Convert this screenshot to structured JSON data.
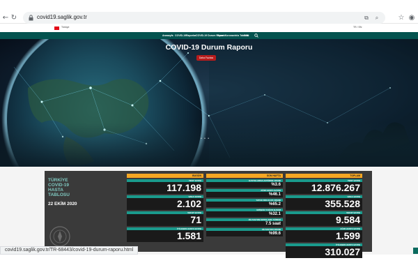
{
  "browser": {
    "url": "covid19.saglik.gov.tr",
    "status_url": "covid19.saglik.gov.tr/TR-68443/covid-19-durum-raporu.html",
    "icons": [
      "back-icon",
      "forward-icon",
      "reload-icon",
      "lock-icon",
      "translate-icon",
      "zoom-icon",
      "star-icon",
      "account-icon"
    ]
  },
  "site": {
    "gov_strip_left": "Türkiye",
    "gov_strip_right": "TR / EN",
    "nav": [
      "Anasayfa",
      "COVID-19",
      "Raporlar",
      "COVID-19 Durum Raporu",
      "Genel Koronavirüs Tablosu",
      "SSS"
    ],
    "search_icon": "search-icon"
  },
  "hero": {
    "title": "COVID-19 Durum Raporu",
    "button": "Daha Fazlası",
    "dots": "• • •"
  },
  "stats": {
    "left_title": [
      "TÜRKİYE",
      "COVID-19",
      "HASTA",
      "TABLOSU"
    ],
    "date": "22 EKİM 2020",
    "columns": [
      {
        "header": "BUGÜN",
        "color": "#f5a623",
        "cells": [
          {
            "label": "TEST SAYISI",
            "value": "117.198",
            "size": "big"
          },
          {
            "label": "VAKA SAYISI",
            "value": "2.102",
            "size": "big"
          },
          {
            "label": "VEFAT SAYISI",
            "value": "71",
            "size": "big"
          },
          {
            "label": "İYİLEŞEN HASTA SAYISI",
            "value": "1.581",
            "size": "big"
          }
        ]
      },
      {
        "header": "SON HAFTA",
        "color": "#f5a623",
        "cells": [
          {
            "label": "HASTALARDA ZATÜRRE ORANI",
            "value": "%3.6",
            "size": "small"
          },
          {
            "label": "AĞIR HASTA SAYISI",
            "value": "%46.1",
            "size": "small"
          },
          {
            "label": "YATAK DOLULUK ORANI",
            "value": "%65.2",
            "size": "small"
          },
          {
            "label": "ERİŞKİN YOĞUN BAKIM",
            "value": "%32.1",
            "size": "small"
          },
          {
            "label": "FİLYASYON ORTALAMA SÜRESİ",
            "value": "7.5 saat",
            "size": "small"
          },
          {
            "label": "FİLYASYON ORANI",
            "value": "%99.6",
            "size": "small"
          }
        ]
      },
      {
        "header": "TOPLAM",
        "color": "#f5a623",
        "cells": [
          {
            "label": "TEST SAYISI",
            "value": "12.876.267",
            "size": "big"
          },
          {
            "label": "VAKA SAYISI",
            "value": "355.528",
            "size": "big"
          },
          {
            "label": "VEFAT SAYISI",
            "value": "9.584",
            "size": "big"
          },
          {
            "label": "AĞIR HASTA SAYISI",
            "value": "1.599",
            "size": "big"
          },
          {
            "label": "İYİLEŞEN HASTA SAYISI",
            "value": "310.027",
            "size": "big"
          }
        ]
      }
    ]
  }
}
